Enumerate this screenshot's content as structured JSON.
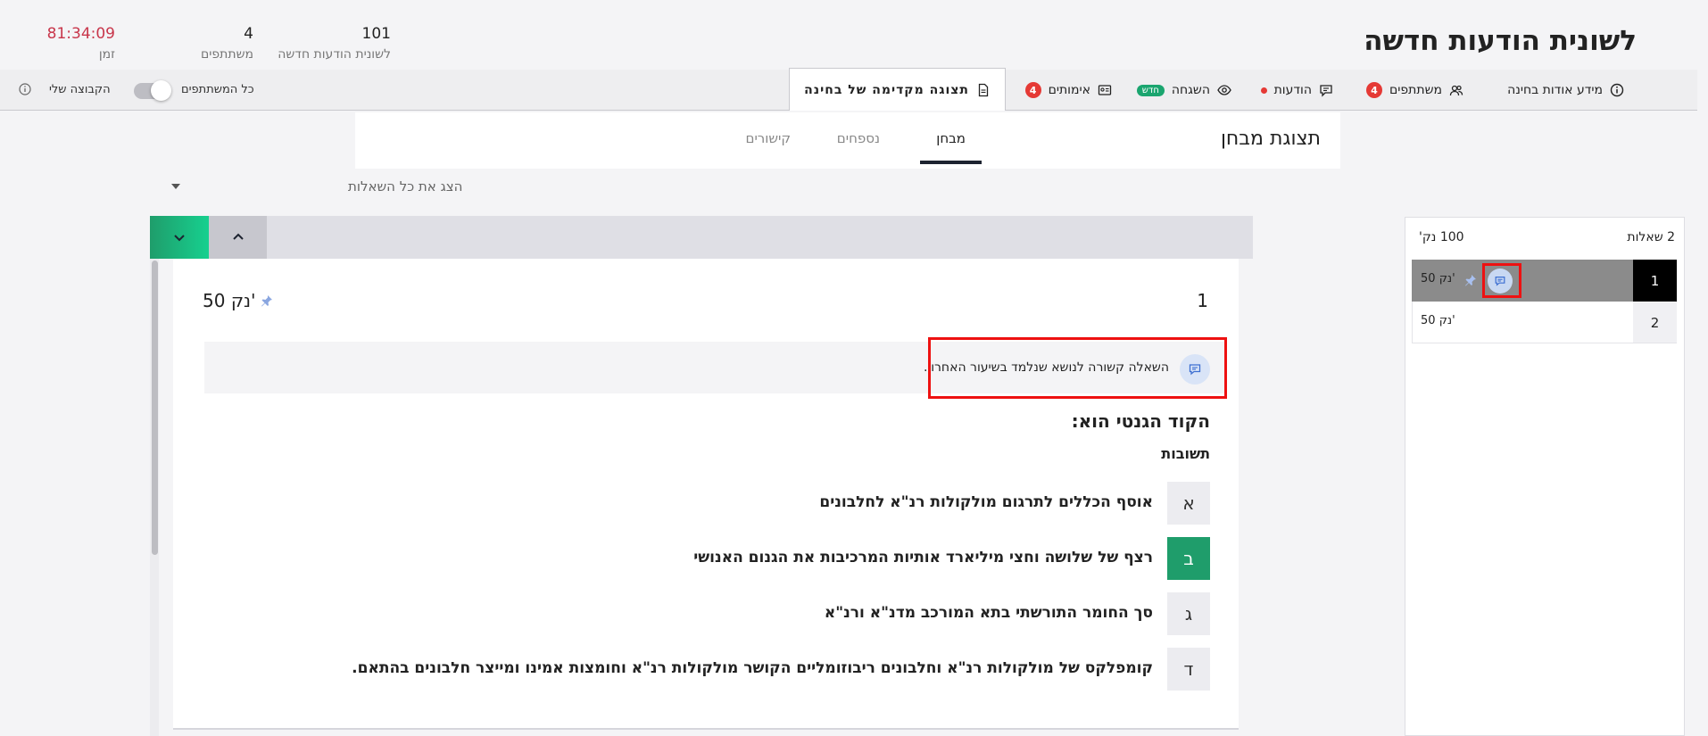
{
  "header": {
    "title": "לשונית הודעות חדשה",
    "stats": [
      {
        "value": "101",
        "label": "לשונית הודעות חדשה"
      },
      {
        "value": "4",
        "label": "משתתפים"
      },
      {
        "value": "81:34:09",
        "label": "זמן"
      }
    ]
  },
  "nav": {
    "info": "מידע אודות בחינה",
    "participants": "משתתפים",
    "participants_badge": "4",
    "messages": "הודעות",
    "supervision": "השגחה",
    "supervision_badge": "חדש",
    "verifications": "אימותים",
    "verifications_badge": "4",
    "preview": "תצוגה מקדימה של בחינה",
    "all_users": "כל המשתתפים",
    "my_group": "הקבוצה שלי"
  },
  "preview": {
    "title": "תצוגת מבחן",
    "tabs": [
      "מבחן",
      "נספחים",
      "קישורים"
    ],
    "show_all": "הצג את כל השאלות"
  },
  "question": {
    "number": "1",
    "points": "50 נק'",
    "comment": "השאלה קשורה לנושא שנלמד בשיעור האחרון.",
    "heading": "הקוד הגנטי הוא:",
    "answers_label": "תשובות",
    "answers": [
      {
        "letter": "א",
        "text": "אוסף הכללים לתרגום מולקולות רנ\"א לחלבונים",
        "correct": false
      },
      {
        "letter": "ב",
        "text": "רצף של שלושה וחצי מיליארד אותיות המרכיבות את הגנום האנושי",
        "correct": true
      },
      {
        "letter": "ג",
        "text": "סך החומר התורשתי בתא המורכב מדנ\"א ורנ\"א",
        "correct": false
      },
      {
        "letter": "ד",
        "text": "קומפלקס של מולקולות רנ\"א וחלבונים ריבוזומליים הקושר מולקולות רנ\"א וחומצות אמינו ומייצר חלבונים בהתאם.",
        "correct": false
      }
    ]
  },
  "sidebar": {
    "count": "2 שאלות",
    "total": "100 נק'",
    "rows": [
      {
        "num": "1",
        "points": "50 נק'"
      },
      {
        "num": "2",
        "points": "50 נק'"
      }
    ]
  }
}
